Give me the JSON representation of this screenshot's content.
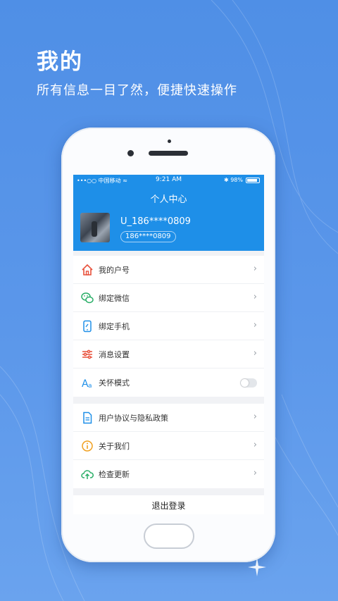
{
  "hero": {
    "title": "我的",
    "subtitle": "所有信息一目了然，便捷快速操作"
  },
  "status_bar": {
    "carrier": "•••○○ 中国移动 ≈",
    "time": "9:21 AM",
    "battery": "✱ 98%"
  },
  "profile": {
    "screen_title": "个人中心",
    "username": "U_186****0809",
    "phone": "186****0809"
  },
  "menu_group_1": [
    {
      "label": "我的户号",
      "icon": "home-icon",
      "color": "#e8503a"
    },
    {
      "label": "绑定微信",
      "icon": "wechat-icon",
      "color": "#2aae67"
    },
    {
      "label": "绑定手机",
      "icon": "phone-icon",
      "color": "#1e8fe8"
    },
    {
      "label": "消息设置",
      "icon": "sliders-icon",
      "color": "#e8503a"
    },
    {
      "label": "关怀模式",
      "icon": "font-size-icon",
      "color": "#1e8fe8",
      "toggle": false
    }
  ],
  "menu_group_2": [
    {
      "label": "用户协议与隐私政策",
      "icon": "document-icon",
      "color": "#1e8fe8"
    },
    {
      "label": "关于我们",
      "icon": "info-icon",
      "color": "#f0a020"
    },
    {
      "label": "检查更新",
      "icon": "cloud-upload-icon",
      "color": "#2aae67"
    }
  ],
  "logout_label": "退出登录",
  "chevron": "›"
}
